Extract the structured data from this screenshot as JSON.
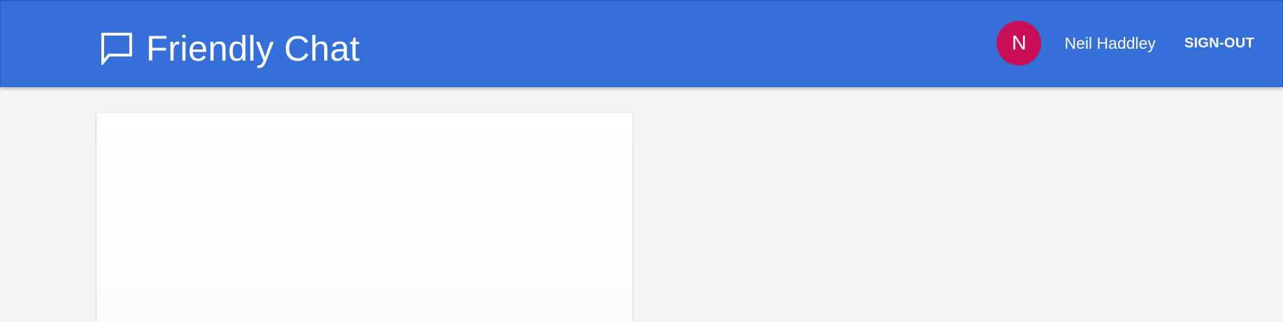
{
  "header": {
    "title": "Friendly Chat",
    "logo_icon": "chat-bubble-icon",
    "background_color": "#356fd9"
  },
  "user": {
    "avatar_initial": "N",
    "avatar_color": "#c80e56",
    "name": "Neil Haddley",
    "signout_label": "SIGN-OUT"
  },
  "page": {
    "background_color": "#f4f4f4"
  },
  "messages_card": {
    "messages": []
  }
}
